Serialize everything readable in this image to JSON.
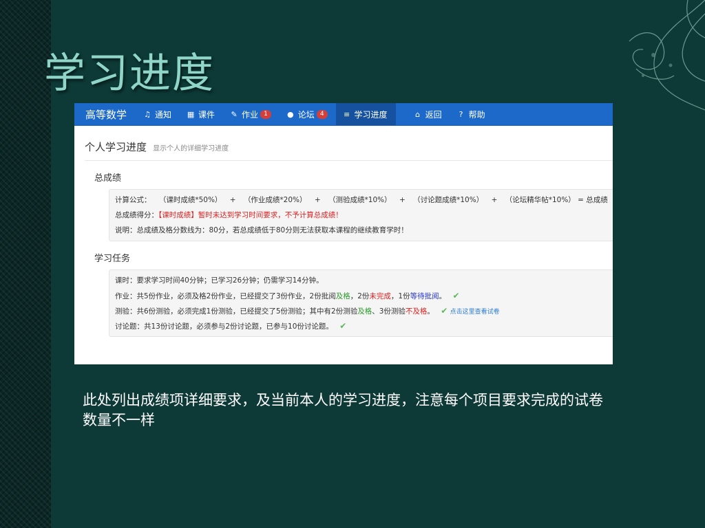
{
  "slide": {
    "title": "学习进度",
    "caption": "此处列出成绩项详细要求，及当前本人的学习进度，注意每个项目要求完成的试卷数量不一样"
  },
  "navbar": {
    "brand": "高等数学",
    "items": [
      {
        "label": "通知",
        "icon": "bell-icon"
      },
      {
        "label": "课件",
        "icon": "film-icon"
      },
      {
        "label": "作业",
        "icon": "pencil-icon",
        "badge": "1"
      },
      {
        "label": "论坛",
        "icon": "comment-icon",
        "badge": "4"
      },
      {
        "label": "学习进度",
        "icon": "list-icon",
        "active": true
      },
      {
        "label": "返回",
        "icon": "home-icon"
      },
      {
        "label": "帮助",
        "icon": "question-icon"
      }
    ]
  },
  "header": {
    "title": "个人学习进度",
    "subtitle": "显示个人的详细学习进度"
  },
  "total": {
    "title": "总成绩",
    "formula_label": "计算公式：",
    "formula_items": [
      "（课时成绩*50%）",
      "（作业成绩*20%）",
      "（测验成绩*10%）",
      "（讨论题成绩*10%）",
      "（论坛精华帖*10%）"
    ],
    "formula_plus": "+",
    "formula_result": "= 总成绩",
    "score_label": "总成绩得分：",
    "score_value": "【课时成绩】暂时未达到学习时间要求，不予计算总成绩！",
    "note": "说明：总成绩及格分数线为：80分，若总成绩低于80分则无法获取本课程的继续教育学时！"
  },
  "tasks": {
    "title": "学习任务",
    "hours": "课时：要求学习时间40分钟；已学习26分钟；仍需学习14分钟。",
    "homework": {
      "pre": "作业：共5份作业，必须及格2份作业，已经提交了3份作业，2份批阅",
      "pass": "及格",
      "mid": "，2份",
      "incomplete": "未完成",
      "mid2": "，1份",
      "pending": "等待批阅",
      "end": "。"
    },
    "quiz": {
      "pre": "测验：共6份测验，必须完成1份测验，已经提交了5份测验；其中有2份测验",
      "pass": "及格",
      "mid": "、3份测验",
      "fail": "不及格",
      "end": "。",
      "link": "点击这里查看试卷"
    },
    "discussion": "讨论题：共13份讨论题，必须参与2份讨论题，已参与10份讨论题。"
  },
  "colors": {
    "background": "#0d3a37",
    "title": "#8fd5c8",
    "navbar": "#1c69c9",
    "badge": "#d43f3a",
    "red": "#e02020",
    "green": "#2a9a2a"
  }
}
